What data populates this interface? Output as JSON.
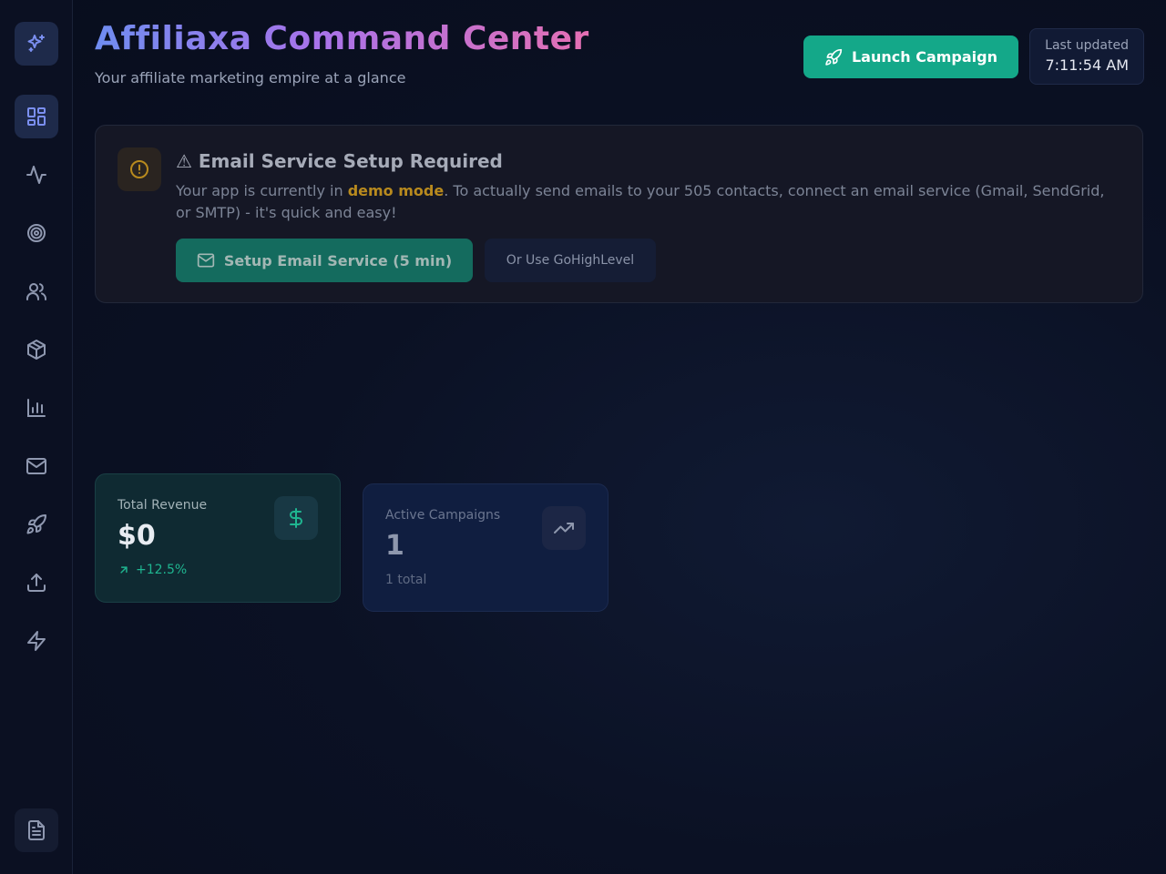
{
  "header": {
    "title": "Affiliaxa Command Center",
    "subtitle": "Your affiliate marketing empire at a glance",
    "launch_label": "Launch Campaign",
    "last_updated_label": "Last updated",
    "last_updated_time": "7:11:54 AM"
  },
  "sidebar": {
    "items": [
      {
        "icon": "sparkles-icon"
      },
      {
        "icon": "dashboard-grid-icon",
        "active": true
      },
      {
        "icon": "activity-icon"
      },
      {
        "icon": "target-icon"
      },
      {
        "icon": "users-icon"
      },
      {
        "icon": "package-icon"
      },
      {
        "icon": "bar-chart-icon"
      },
      {
        "icon": "mail-icon"
      },
      {
        "icon": "rocket-icon"
      },
      {
        "icon": "upload-icon"
      },
      {
        "icon": "zap-icon"
      },
      {
        "icon": "file-text-icon"
      }
    ]
  },
  "alert": {
    "title": "⚠ Email Service Setup Required",
    "text_before": "Your app is currently in ",
    "text_highlight": "demo mode",
    "text_after": ". To actually send emails to your 505 contacts, connect an email service (Gmail, SendGrid, or SMTP) - it's quick and easy!",
    "setup_label": "Setup Email Service (5 min)",
    "ghl_label": "Or Use GoHighLevel"
  },
  "stats": {
    "revenue": {
      "label": "Total Revenue",
      "value": "$0",
      "change": "+12.5%"
    },
    "campaigns": {
      "label": "Active Campaigns",
      "value": "1",
      "sub": "1 total"
    }
  },
  "colors": {
    "accent": "#14a889",
    "title_gradient": [
      "#6f8df0",
      "#a873ea",
      "#e46fb3"
    ],
    "warning": "#b88a1e"
  }
}
